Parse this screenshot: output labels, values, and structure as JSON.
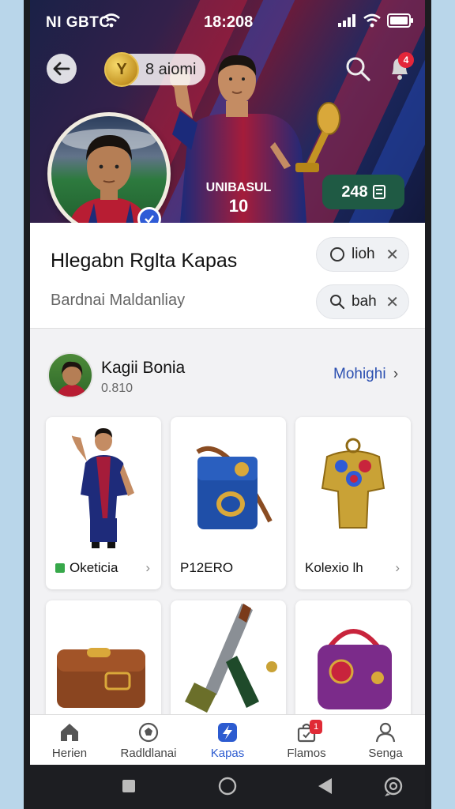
{
  "status_bar": {
    "carrier": "NI GBTC",
    "time": "18:208"
  },
  "header": {
    "coin_symbol": "Y",
    "coin_label": "8 aiomi",
    "notif_count": "4"
  },
  "hero": {
    "jersey_text": "UNIBASUL",
    "jersey_number": "10",
    "points": "248"
  },
  "profile": {
    "name": "Hlegabn Rglta Kapas",
    "subtitle": "Bardnai Maldanliay",
    "chips": [
      {
        "label": "lioh"
      },
      {
        "label": "bah"
      }
    ]
  },
  "section": {
    "title": "Kagii Bonia",
    "meta": "0.810",
    "link": "Mohighi"
  },
  "items": [
    {
      "label": "Oketicia",
      "tag": "green"
    },
    {
      "label": "P12ERO"
    },
    {
      "label": "Kolexio lh"
    },
    {
      "label": ""
    },
    {
      "label": ""
    },
    {
      "label": ""
    }
  ],
  "bottom_nav": [
    {
      "label": "Herien",
      "icon": "home-icon"
    },
    {
      "label": "Radldlanai",
      "icon": "football-icon"
    },
    {
      "label": "Kapas",
      "icon": "bolt-icon",
      "active": true
    },
    {
      "label": "Flamos",
      "icon": "bag-icon",
      "badge": "1"
    },
    {
      "label": "Senga",
      "icon": "user-icon"
    }
  ],
  "colors": {
    "accent": "#2c5bd0",
    "points_bg": "#1f5a44",
    "badge": "#e3263a"
  }
}
